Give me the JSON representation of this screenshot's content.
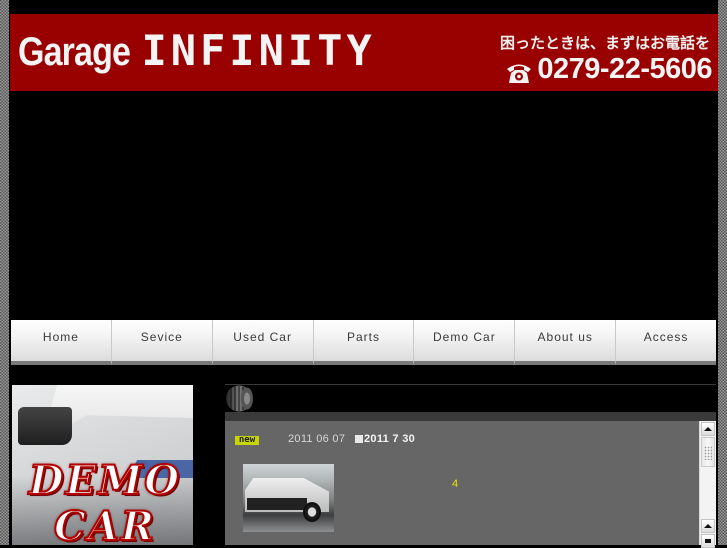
{
  "header": {
    "logo_garage": "Garage",
    "logo_infinity": "INFINITY",
    "tagline": "困ったときは、まずはお電話を",
    "phone_icon": "telephone-icon",
    "phone_number": "0279-22-5606",
    "banner_color": "#990000"
  },
  "nav": {
    "items": [
      {
        "label": "Home"
      },
      {
        "label": "Sevice"
      },
      {
        "label": "Used Car"
      },
      {
        "label": "Parts"
      },
      {
        "label": "Demo Car"
      },
      {
        "label": "About us"
      },
      {
        "label": "Access"
      }
    ]
  },
  "sidebar": {
    "banner_line1": "DEMO",
    "banner_line2": "CAR"
  },
  "news": {
    "header_icon": "tire-icon",
    "items": [
      {
        "badge": "new",
        "date": "2011 06 07",
        "event_icon": "square-icon",
        "event_date": "2011  7  30",
        "number": "4"
      }
    ]
  },
  "colors": {
    "badge": "#c8d600",
    "highlight_text": "#f0e000",
    "panel_bg": "#666666"
  }
}
